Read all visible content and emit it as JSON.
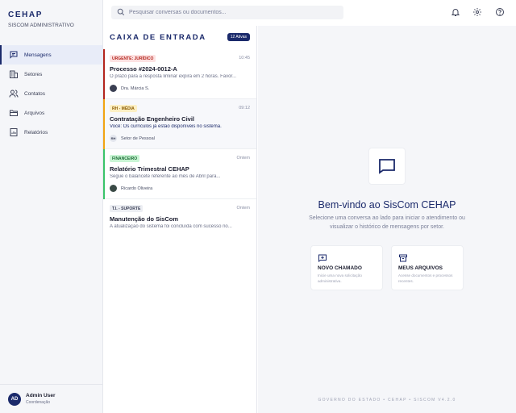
{
  "brand": {
    "title": "CEHAP",
    "subtitle": "SISCOM ADMINISTRATIVO"
  },
  "sidebar": {
    "items": [
      {
        "label": "Mensagens",
        "icon": "message-icon",
        "active": true
      },
      {
        "label": "Setores",
        "icon": "building-icon",
        "active": false
      },
      {
        "label": "Contatos",
        "icon": "contacts-icon",
        "active": false
      },
      {
        "label": "Arquivos",
        "icon": "folder-icon",
        "active": false
      },
      {
        "label": "Relatórios",
        "icon": "report-icon",
        "active": false
      }
    ],
    "user": {
      "initials": "AD",
      "name": "Admin User",
      "role": "Coordenação"
    }
  },
  "topbar": {
    "search_placeholder": "Pesquisar conversas ou documentos...",
    "icons": [
      "bell-icon",
      "gear-icon",
      "help-icon"
    ]
  },
  "inbox": {
    "title": "CAIXA DE ENTRADA",
    "badge": "12 Ativas",
    "conversations": [
      {
        "tag": "URGENTE: JURÍDICO",
        "tag_bg": "#fde2e2",
        "tag_color": "#b3261e",
        "bar_color": "#b3261e",
        "time": "10:45",
        "subject": "Processo #2024-0012-A",
        "preview": "O prazo para a resposta liminar expira em 2 horas. Favor...",
        "sender_initials": "",
        "sender": "Dra. Márcia S.",
        "unread": false
      },
      {
        "tag": "RH - MÉDIA",
        "tag_bg": "#fdf0c4",
        "tag_color": "#8a5a00",
        "bar_color": "#f2a413",
        "time": "09:12",
        "subject": "Contratação Engenheiro Civil",
        "preview": "Você: Os currículos já estão disponíveis no sistema.",
        "sender_initials": "RH",
        "sender": "Setor de Pessoal",
        "unread": true
      },
      {
        "tag": "FINANCEIRO",
        "tag_bg": "#c9f5d4",
        "tag_color": "#1a6b34",
        "bar_color": "#3bc46a",
        "time": "Ontem",
        "subject": "Relatório Trimestral CEHAP",
        "preview": "Segue o balancete referente ao mês de Abril para...",
        "sender_initials": "",
        "sender": "Ricardo Oliveira",
        "unread": false
      },
      {
        "tag": "T.I. - SUPORTE",
        "tag_bg": "#eceef3",
        "tag_color": "#3c4157",
        "bar_color": "",
        "time": "Ontem",
        "subject": "Manutenção do SisCom",
        "preview": "A atualização do sistema foi concluída com sucesso no...",
        "sender_initials": "",
        "sender": "",
        "unread": false
      }
    ]
  },
  "main": {
    "welcome_title": "Bem-vindo ao SisCom CEHAP",
    "welcome_subtitle": "Selecione uma conversa ao lado para iniciar o atendimento ou visualizar o histórico de mensagens por setor.",
    "cards": [
      {
        "title": "NOVO CHAMADO",
        "desc": "Inicie uma nova solicitação administrativa.",
        "icon": "new-ticket-icon"
      },
      {
        "title": "MEUS ARQUIVOS",
        "desc": "Acesse documentos e processos recentes.",
        "icon": "archive-icon"
      }
    ],
    "footer": "GOVERNO DO ESTADO • CEHAP • SISCOM V4.2.0"
  },
  "colors": {
    "primary": "#1b2a6b",
    "background": "#f5f6f9"
  }
}
